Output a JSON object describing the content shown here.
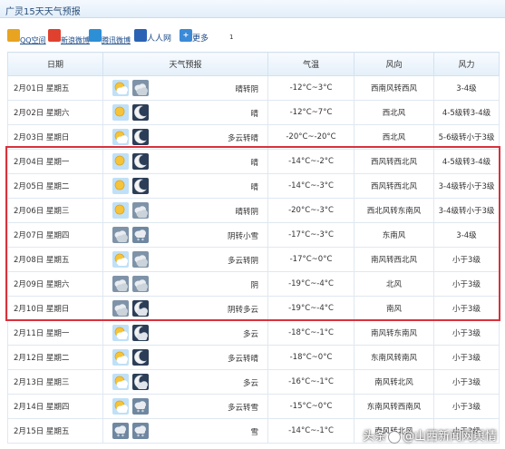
{
  "window": {
    "title": "广灵15天天气预报"
  },
  "share": {
    "items": [
      {
        "label": "QQ空间",
        "icon": "qzone-icon",
        "color": "#e8a320"
      },
      {
        "label": "新浪微博",
        "icon": "weibo-icon",
        "color": "#e0412f"
      },
      {
        "label": "腾讯微博",
        "icon": "tencent-weibo-icon",
        "color": "#2d8fd5"
      },
      {
        "label": "人人网",
        "icon": "renren-icon",
        "color": "#2b63b4"
      },
      {
        "label": "更多",
        "icon": "plus-icon",
        "color": "#3b8ad8"
      }
    ],
    "count": "1"
  },
  "table": {
    "headers": [
      "日期",
      "天气预报",
      "气温",
      "风向",
      "风力"
    ],
    "rows": [
      {
        "date": "2月01日 星期五",
        "icons": [
          "sun-cloud",
          "cloud"
        ],
        "desc": "晴转阴",
        "temp": "-12°C~3°C",
        "wind_dir": "西南风转西风",
        "wind_force": "3-4级"
      },
      {
        "date": "2月02日 星期六",
        "icons": [
          "sun",
          "moon"
        ],
        "desc": "晴",
        "temp": "-12°C~7°C",
        "wind_dir": "西北风",
        "wind_force": "4-5级转3-4级"
      },
      {
        "date": "2月03日 星期日",
        "icons": [
          "sun-cloud",
          "moon"
        ],
        "desc": "多云转晴",
        "temp": "-20°C~-20°C",
        "wind_dir": "西北风",
        "wind_force": "5-6级转小于3级"
      },
      {
        "date": "2月04日 星期一",
        "icons": [
          "sun",
          "moon"
        ],
        "desc": "晴",
        "temp": "-14°C~-2°C",
        "wind_dir": "西风转西北风",
        "wind_force": "4-5级转3-4级"
      },
      {
        "date": "2月05日 星期二",
        "icons": [
          "sun",
          "moon"
        ],
        "desc": "晴",
        "temp": "-14°C~-3°C",
        "wind_dir": "西风转西北风",
        "wind_force": "3-4级转小于3级"
      },
      {
        "date": "2月06日 星期三",
        "icons": [
          "sun",
          "cloud"
        ],
        "desc": "晴转阴",
        "temp": "-20°C~-3°C",
        "wind_dir": "西北风转东南风",
        "wind_force": "3-4级转小于3级"
      },
      {
        "date": "2月07日 星期四",
        "icons": [
          "cloud",
          "snow"
        ],
        "desc": "阴转小雪",
        "temp": "-17°C~-3°C",
        "wind_dir": "东南风",
        "wind_force": "3-4级"
      },
      {
        "date": "2月08日 星期五",
        "icons": [
          "sun-cloud",
          "cloud"
        ],
        "desc": "多云转阴",
        "temp": "-17°C~0°C",
        "wind_dir": "南风转西北风",
        "wind_force": "小于3级"
      },
      {
        "date": "2月09日 星期六",
        "icons": [
          "cloud",
          "cloud"
        ],
        "desc": "阴",
        "temp": "-19°C~-4°C",
        "wind_dir": "北风",
        "wind_force": "小于3级"
      },
      {
        "date": "2月10日 星期日",
        "icons": [
          "cloud",
          "moon-cloud"
        ],
        "desc": "阴转多云",
        "temp": "-19°C~-4°C",
        "wind_dir": "南风",
        "wind_force": "小于3级"
      },
      {
        "date": "2月11日 星期一",
        "icons": [
          "sun-cloud",
          "moon-cloud"
        ],
        "desc": "多云",
        "temp": "-18°C~-1°C",
        "wind_dir": "南风转东南风",
        "wind_force": "小于3级"
      },
      {
        "date": "2月12日 星期二",
        "icons": [
          "sun-cloud",
          "moon"
        ],
        "desc": "多云转晴",
        "temp": "-18°C~0°C",
        "wind_dir": "东南风转南风",
        "wind_force": "小于3级"
      },
      {
        "date": "2月13日 星期三",
        "icons": [
          "sun-cloud",
          "moon-cloud"
        ],
        "desc": "多云",
        "temp": "-16°C~-1°C",
        "wind_dir": "南风转北风",
        "wind_force": "小于3级"
      },
      {
        "date": "2月14日 星期四",
        "icons": [
          "sun-cloud",
          "snow"
        ],
        "desc": "多云转雪",
        "temp": "-15°C~0°C",
        "wind_dir": "东南风转西南风",
        "wind_force": "小于3级"
      },
      {
        "date": "2月15日 星期五",
        "icons": [
          "snow",
          "snow"
        ],
        "desc": "雪",
        "temp": "-14°C~-1°C",
        "wind_dir": "南风转北风",
        "wind_force": "小于3级"
      }
    ]
  },
  "highlight": {
    "color": "#d7323d",
    "rows": "2月04日–2月10日"
  },
  "watermark": {
    "prefix": "头条",
    "handle": "@山西新闻网舆情"
  }
}
